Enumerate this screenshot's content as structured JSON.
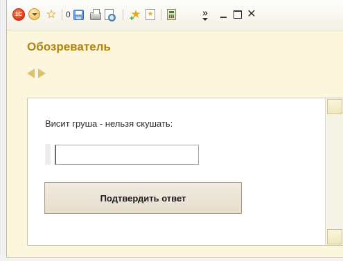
{
  "window": {
    "title": "Обозреватель",
    "toolbar": {
      "logo_text": "1С",
      "counter": "0",
      "icons": [
        "1c-logo-icon",
        "main-menu-icon",
        "favorites-star-icon",
        "save-icon",
        "print-icon",
        "print-preview-icon",
        "add-to-favorites-icon",
        "favorites-list-icon",
        "calculator-icon",
        "more-commands-icon",
        "minimize-icon",
        "maximize-icon",
        "close-icon"
      ],
      "more_label": "»",
      "close_label": "✕",
      "star_glyph": "☆",
      "fav_glyph": "★"
    }
  },
  "navigation": {
    "back_icon": "triangle-left",
    "forward_icon": "triangle-right"
  },
  "form": {
    "question_label": "Висит груша - нельзя скушать:",
    "answer_value": "",
    "answer_placeholder": "",
    "submit_label": "Подтвердить ответ"
  },
  "colors": {
    "title": "#b08410",
    "form_background": "#fbf6dc",
    "nav_arrows": "#dcc270",
    "button_background": "#e6ddcc"
  }
}
